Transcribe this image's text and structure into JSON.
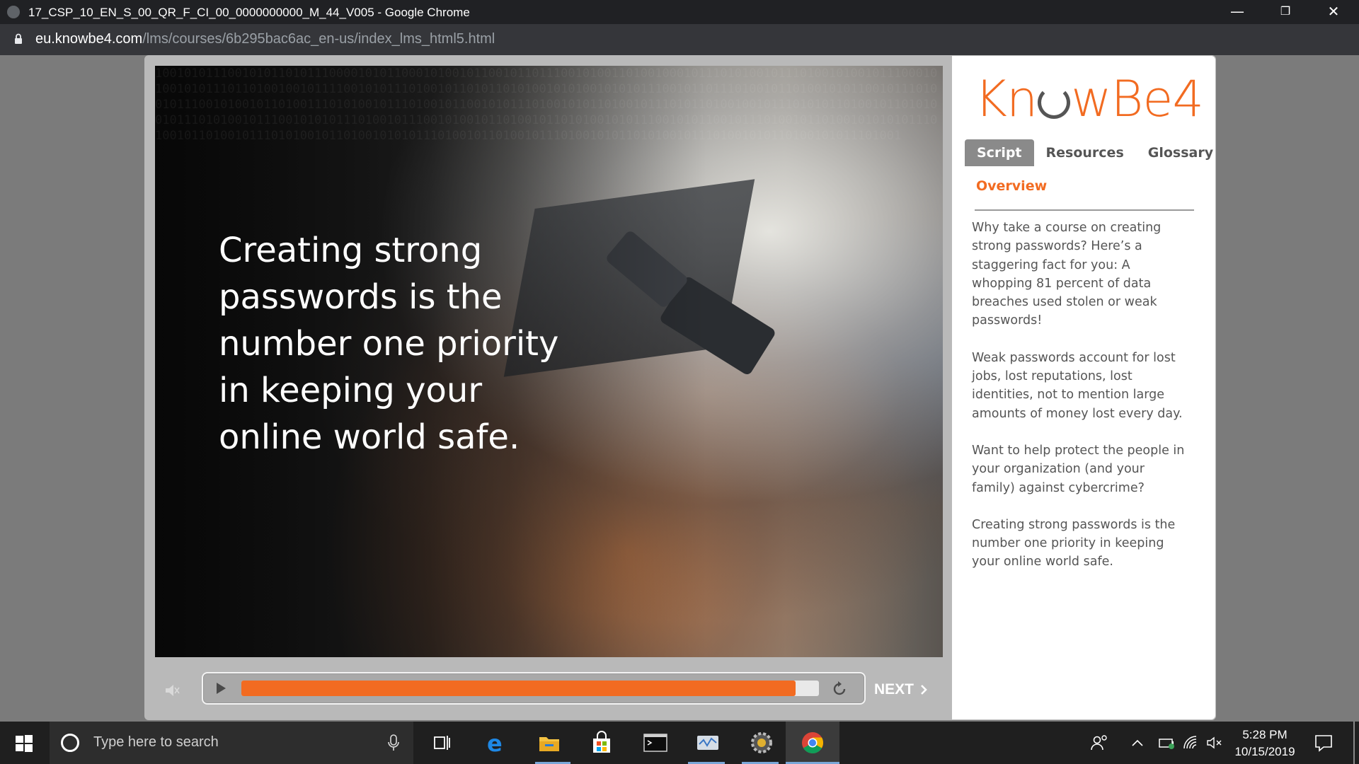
{
  "browser": {
    "window_title": "17_CSP_10_EN_S_00_QR_F_CI_00_0000000000_M_44_V005 - Google Chrome",
    "url_host": "eu.knowbe4.com",
    "url_path": "/lms/courses/6b295bac6ac_en-us/index_lms_html5.html",
    "minimize_glyph": "—",
    "restore_glyph": "❐",
    "close_glyph": "✕"
  },
  "slide": {
    "headline_lines": [
      "Creating strong",
      "passwords is the",
      "number one priority",
      "in keeping your",
      "online world safe."
    ],
    "binary_text": "1001010111001010110101110000101011000101001011001011011100101001101001000101110101001011101001010010111000101001010111011010010010111100101011101001011010110101001010100101010111001011011101001011010010101100101110100101110010100101101001110101001011101001011001010111010010101101001011101011010010010111010101101001011010100101110101001011100101010111010010111001010010110100101101010010101110010101100101110100101101001010101011101001011010010111010100101101001010101110100101101001011101001010110101001011101001010110100101011101001"
  },
  "player": {
    "progress": 0.96,
    "next_label": "NEXT",
    "accent_color": "#f26b21"
  },
  "panel": {
    "logo_left": "Kn",
    "logo_right": "wBe4",
    "tabs": [
      {
        "label": "Script",
        "active": true
      },
      {
        "label": "Resources",
        "active": false
      },
      {
        "label": "Glossary",
        "active": false
      }
    ],
    "section_title": "Overview",
    "paragraphs": [
      "Why take a course on creating strong passwords? Here’s a staggering fact for you: A whopping 81 percent of data breaches used stolen or weak passwords!",
      "Weak passwords account for lost jobs, lost reputations, lost identities, not to mention large amounts of money lost every day.",
      "Want to help protect the people in your organization (and your family) against cybercrime?",
      "Creating strong passwords is the number one priority in keeping your online world safe."
    ]
  },
  "taskbar": {
    "search_placeholder": "Type here to search",
    "time": "5:28 PM",
    "date": "10/15/2019",
    "pinned": [
      "task-view-icon",
      "edge-icon",
      "file-explorer-icon",
      "store-icon",
      "terminal-icon",
      "network-tool-icon",
      "settings-gear-icon",
      "chrome-icon"
    ]
  }
}
